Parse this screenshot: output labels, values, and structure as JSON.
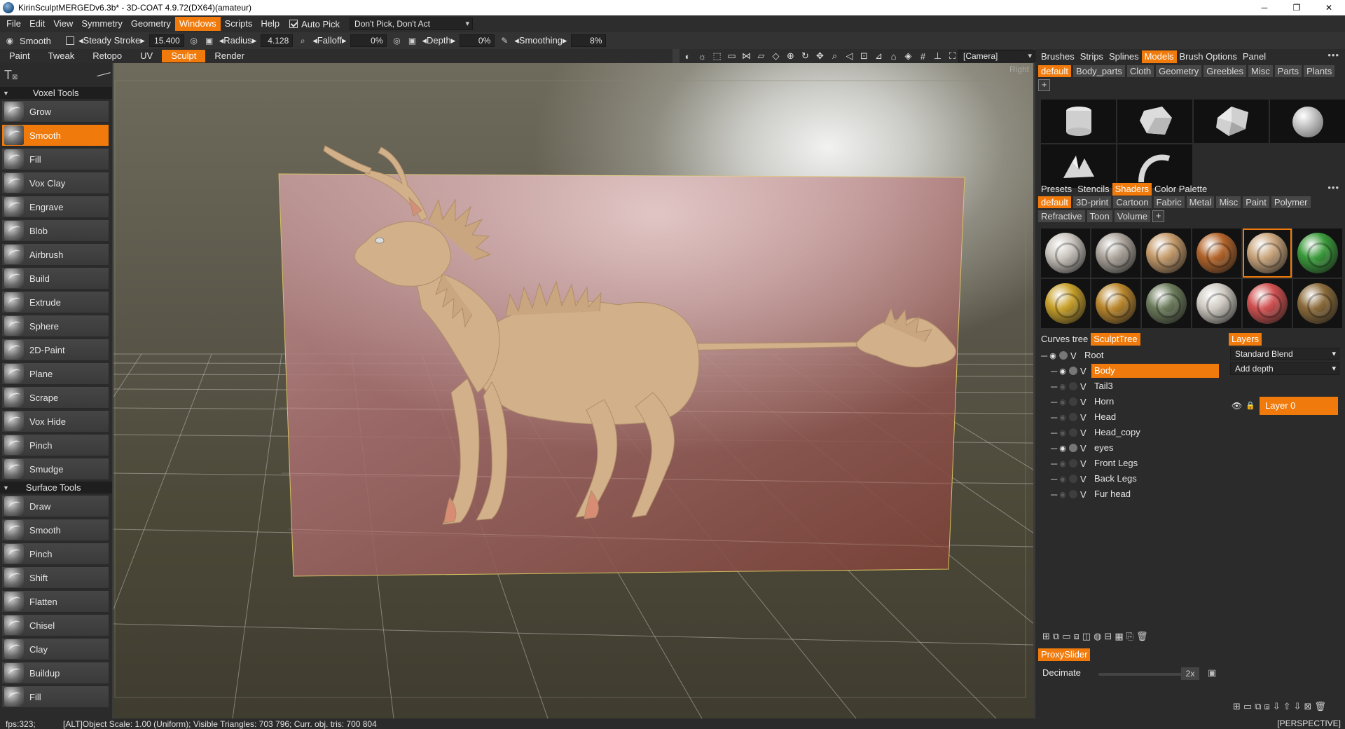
{
  "window": {
    "title": "KirinSculptMERGEDv6.3b* - 3D-COAT 4.9.72(DX64)(amateur)",
    "minimize": "─",
    "maximize": "❐",
    "close": "✕"
  },
  "menu": {
    "items": [
      "File",
      "Edit",
      "View",
      "Symmetry",
      "Geometry",
      "Windows",
      "Scripts",
      "Help"
    ],
    "active_index": 5,
    "auto_pick_label": "Auto  Pick",
    "pick_mode_value": "Don't  Pick,  Don't  Act"
  },
  "tool_options": {
    "tool_name": "Smooth",
    "steady_stroke_label": "Steady  Stroke",
    "steady_stroke_value": "15.400",
    "radius_label": "Radius",
    "radius_value": "4.128",
    "falloff_label": "Falloff",
    "falloff_value": "0%",
    "depth_label": "Depth",
    "depth_value": "0%",
    "smoothing_label": "Smoothing",
    "smoothing_value": "8%"
  },
  "rooms": {
    "tabs": [
      "Paint",
      "Tweak",
      "Retopo",
      "UV",
      "Sculpt",
      "Render"
    ],
    "active_index": 4
  },
  "viewport": {
    "camera_value": "[Camera]",
    "view_label": "Right"
  },
  "voxel_tools": {
    "header": "Voxel  Tools",
    "items": [
      "Grow",
      "Smooth",
      "Fill",
      "Vox  Clay",
      "Engrave",
      "Blob",
      "Airbrush",
      "Build",
      "Extrude",
      "Sphere",
      "2D-Paint",
      "Plane",
      "Scrape",
      "Vox  Hide",
      "Pinch",
      "Smudge"
    ],
    "active_index": 1
  },
  "surface_tools": {
    "header": "Surface  Tools",
    "items": [
      "Draw",
      "Smooth",
      "Pinch",
      "Shift",
      "Flatten",
      "Chisel",
      "Clay",
      "Buildup",
      "Fill"
    ]
  },
  "top_tabs": {
    "items": [
      "Brushes",
      "Strips",
      "Splines",
      "Models",
      "Brush  Options",
      "Panel"
    ],
    "active_index": 3
  },
  "model_categories": {
    "items": [
      "default",
      "Body_parts",
      "Cloth",
      "Geometry",
      "Greebles",
      "Misc",
      "Parts",
      "Plants"
    ],
    "active_index": 0
  },
  "mid_tabs": {
    "items": [
      "Presets",
      "Stencils",
      "Shaders",
      "Color  Palette"
    ],
    "active_index": 2
  },
  "shader_categories": {
    "items": [
      "default",
      "3D-print",
      "Cartoon",
      "Fabric",
      "Metal",
      "Misc",
      "Paint",
      "Polymer",
      "Refractive",
      "Toon",
      "Volume"
    ],
    "active_index": 0
  },
  "shaders": {
    "colors": [
      "#c9c4bd",
      "#aaa39a",
      "#c49a6a",
      "#b2642a",
      "#c9a57c",
      "#3a9a3a",
      "#c7a02a",
      "#b9862c",
      "#6b7a5a",
      "#cfcac2",
      "#d05050",
      "#8a6a3a"
    ],
    "selected_index": 4
  },
  "tree_tabs": {
    "items": [
      "Curves  tree",
      "SculptTree"
    ],
    "active_index": 1
  },
  "sculpt_tree": {
    "items": [
      {
        "name": "Root",
        "v": "V",
        "visible": true,
        "indent": 0
      },
      {
        "name": "Body",
        "v": "V",
        "visible": true,
        "indent": 1,
        "selected": true
      },
      {
        "name": "Tail3",
        "v": "V",
        "visible": false,
        "indent": 1
      },
      {
        "name": "Horn",
        "v": "V",
        "visible": false,
        "indent": 1
      },
      {
        "name": "Head",
        "v": "V",
        "visible": false,
        "indent": 1
      },
      {
        "name": "Head_copy",
        "v": "V",
        "visible": false,
        "indent": 1
      },
      {
        "name": "eyes",
        "v": "V",
        "visible": true,
        "indent": 1
      },
      {
        "name": "Front  Legs",
        "v": "V",
        "visible": false,
        "indent": 1
      },
      {
        "name": "Back  Legs",
        "v": "V",
        "visible": false,
        "indent": 1
      },
      {
        "name": "Fur  head",
        "v": "V",
        "visible": false,
        "indent": 1
      }
    ]
  },
  "layers": {
    "tab": "Layers",
    "blend_value": "Standard  Blend",
    "depth_value": "Add  depth",
    "layer_name": "Layer  0"
  },
  "proxy": {
    "tab": "ProxySlider",
    "decimate_label": "Decimate",
    "decimate_value": "2x"
  },
  "status": {
    "fps": "fps:323;",
    "info": "[ALT]Object  Scale:  1.00  (Uniform);  Visible  Triangles:  703  796;  Curr.  obj.  tris:  700  804",
    "projection": "[PERSPECTIVE]"
  },
  "colors": {
    "accent": "#f07b0c",
    "panel": "#2b2b2b",
    "clay": "#d4b48e"
  }
}
